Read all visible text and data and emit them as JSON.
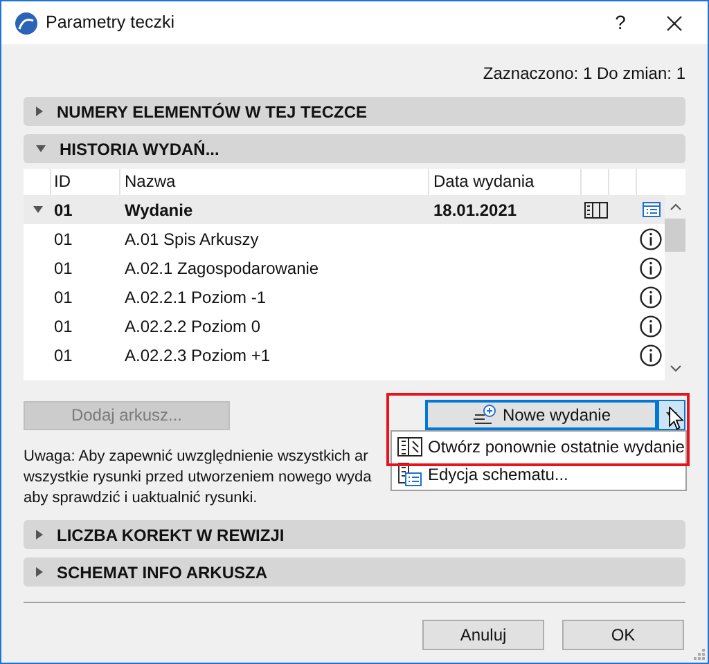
{
  "window": {
    "title": "Parametry teczki",
    "help": "?"
  },
  "selection_status": "Zaznaczono: 1 Do zmian: 1",
  "sections": [
    {
      "title": "NUMERY ELEMENTÓW W TEJ TECZCE",
      "expanded": false
    },
    {
      "title": "HISTORIA WYDAŃ...",
      "expanded": true
    }
  ],
  "table": {
    "columns": [
      "ID",
      "Nazwa",
      "Data wydania"
    ],
    "group": {
      "id": "01",
      "name": "Wydanie",
      "date": "18.01.2021",
      "expanded": true
    },
    "rows": [
      {
        "id": "01",
        "name": "A.01 Spis Arkuszy"
      },
      {
        "id": "01",
        "name": "A.02.1 Zagospodarowanie"
      },
      {
        "id": "01",
        "name": "A.02.2.1 Poziom -1"
      },
      {
        "id": "01",
        "name": "A.02.2.2 Poziom 0"
      },
      {
        "id": "01",
        "name": "A.02.2.3 Poziom +1"
      }
    ]
  },
  "add_sheet": {
    "label": "Dodaj arkusz...",
    "disabled": true
  },
  "new_issue": {
    "label": "Nowe wydanie",
    "menu_open": true
  },
  "menu": [
    {
      "label": "Otwórz ponownie ostatnie wydanie",
      "kind": "reopen"
    },
    {
      "label": "Edycja schematu...",
      "kind": "edit"
    }
  ],
  "note": [
    "Uwaga: Aby zapewnić uwzględnienie wszystkich ar",
    "wszystkie rysunki przed utworzeniem nowego wyda",
    "aby sprawdzić i uaktualnić rysunki."
  ],
  "lower_sections": [
    {
      "title": "LICZBA KOREKT W REWIZJI",
      "expanded": false
    },
    {
      "title": "SCHEMAT INFO ARKUSZA",
      "expanded": false
    }
  ],
  "footer_buttons": [
    "Anuluj",
    "OK"
  ]
}
